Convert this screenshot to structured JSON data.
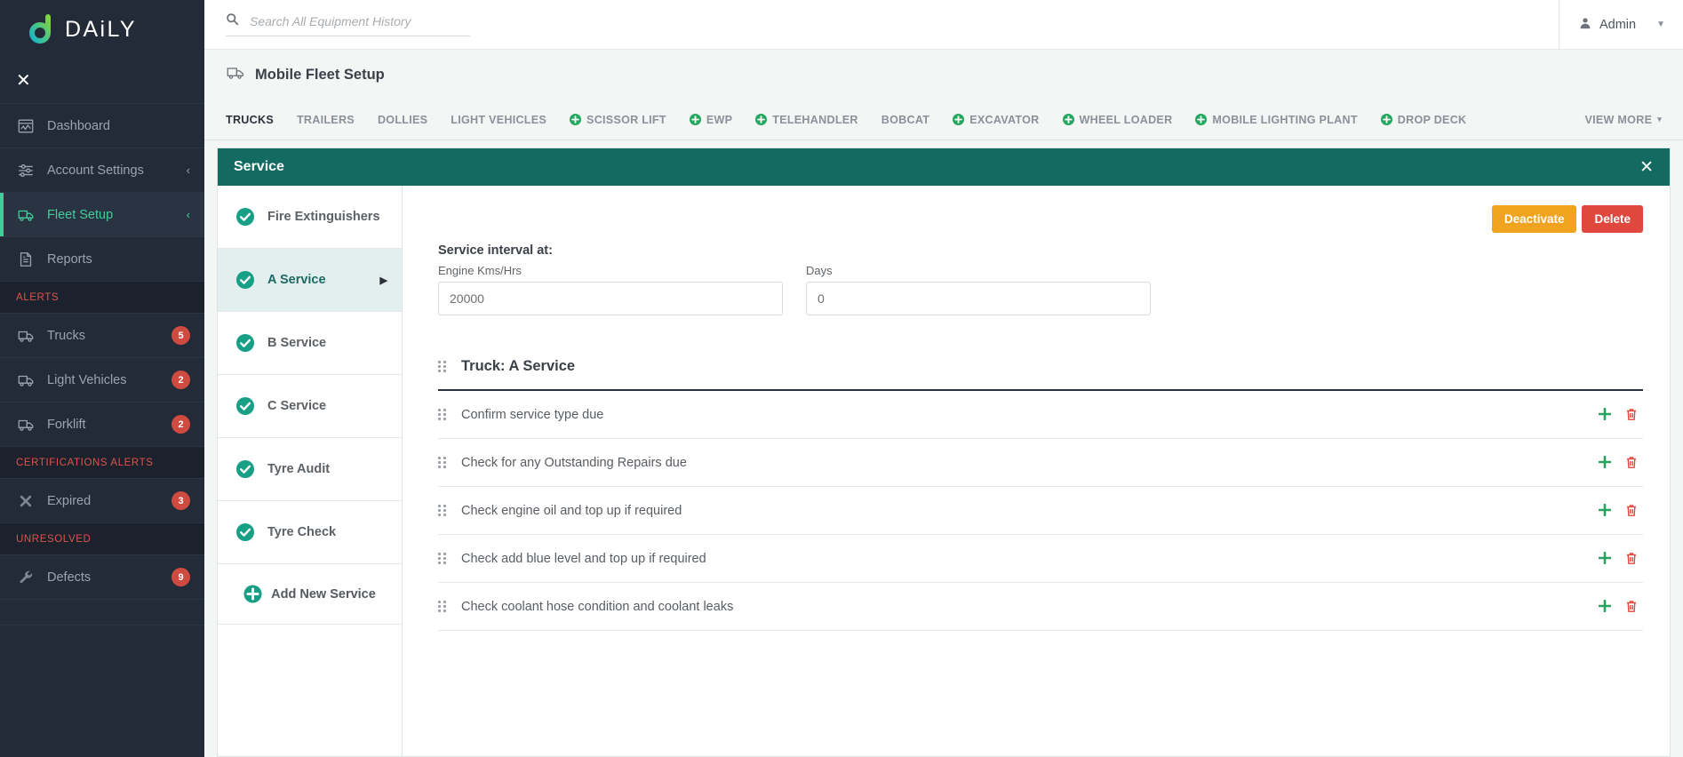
{
  "brand": {
    "name": "DAiLY",
    "logo_icon": "daily-logo-icon",
    "close_icon": "close-icon"
  },
  "sidebar": {
    "items": [
      {
        "label": "Dashboard",
        "icon": "dashboard-chart-icon",
        "chevron": "",
        "active": false
      },
      {
        "label": "Account Settings",
        "icon": "sliders-icon",
        "chevron": "‹",
        "active": false
      },
      {
        "label": "Fleet Setup",
        "icon": "truck-icon",
        "chevron": "‹",
        "active": true
      },
      {
        "label": "Reports",
        "icon": "document-icon",
        "chevron": "",
        "active": false
      }
    ],
    "alerts_heading": "ALERTS",
    "alerts": [
      {
        "label": "Trucks",
        "icon": "truck-icon",
        "badge": "5"
      },
      {
        "label": "Light Vehicles",
        "icon": "truck-icon",
        "badge": "2"
      },
      {
        "label": "Forklift",
        "icon": "truck-icon",
        "badge": "2"
      }
    ],
    "certifications_heading": "CERTIFICATIONS ALERTS",
    "certifications": [
      {
        "label": "Expired",
        "icon": "cross-icon",
        "badge": "3"
      }
    ],
    "unresolved_heading": "UNRESOLVED",
    "unresolved": [
      {
        "label": "Defects",
        "icon": "wrench-icon",
        "badge": "9"
      }
    ]
  },
  "topbar": {
    "search_placeholder": "Search All Equipment History",
    "search_value": "",
    "search_icon": "search-icon",
    "user_label": "Admin",
    "user_icon": "user-icon",
    "caret_icon": "chevron-down-icon"
  },
  "page": {
    "title": "Mobile Fleet Setup",
    "title_icon": "truck-icon"
  },
  "tabs": [
    {
      "label": "TRUCKS",
      "plus": false,
      "active": true
    },
    {
      "label": "TRAILERS",
      "plus": false,
      "active": false
    },
    {
      "label": "DOLLIES",
      "plus": false,
      "active": false
    },
    {
      "label": "LIGHT VEHICLES",
      "plus": false,
      "active": false
    },
    {
      "label": "SCISSOR LIFT",
      "plus": true,
      "active": false
    },
    {
      "label": "EWP",
      "plus": true,
      "active": false
    },
    {
      "label": "TELEHANDLER",
      "plus": true,
      "active": false
    },
    {
      "label": "BOBCAT",
      "plus": false,
      "active": false
    },
    {
      "label": "EXCAVATOR",
      "plus": true,
      "active": false
    },
    {
      "label": "WHEEL LOADER",
      "plus": true,
      "active": false
    },
    {
      "label": "MOBILE LIGHTING PLANT",
      "plus": true,
      "active": false
    },
    {
      "label": "DROP DECK",
      "plus": true,
      "active": false
    }
  ],
  "view_more": {
    "label": "VIEW MORE",
    "caret": "▾"
  },
  "panel": {
    "title": "Service",
    "close_icon": "close-icon"
  },
  "services": [
    {
      "label": "Fire Extinguishers",
      "active": false
    },
    {
      "label": "A Service",
      "active": true
    },
    {
      "label": "B Service",
      "active": false
    },
    {
      "label": "C Service",
      "active": false
    },
    {
      "label": "Tyre Audit",
      "active": false
    },
    {
      "label": "Tyre Check",
      "active": false
    }
  ],
  "add_service": {
    "label": "Add New Service",
    "icon": "plus-circle-icon"
  },
  "detail": {
    "deactivate_label": "Deactivate",
    "delete_label": "Delete",
    "interval_heading": "Service interval at:",
    "engine_field_label": "Engine Kms/Hrs",
    "engine_field_value": "20000",
    "days_field_label": "Days",
    "days_field_value": "0",
    "checklist_title": "Truck: A Service",
    "checklist": [
      {
        "text": "Confirm service type due"
      },
      {
        "text": "Check for any Outstanding Repairs due"
      },
      {
        "text": "Check engine oil and top up if required"
      },
      {
        "text": "Check add blue level and top up if required"
      },
      {
        "text": "Check coolant hose condition and coolant leaks"
      }
    ]
  },
  "colors": {
    "sidebar_bg": "#232b38",
    "accent_green": "#3ecf9a",
    "panel_teal": "#126a61",
    "alert_red": "#cf4a3f",
    "deactivate_orange": "#f0a31e",
    "delete_red": "#e0473d",
    "check_teal": "#17a085"
  }
}
